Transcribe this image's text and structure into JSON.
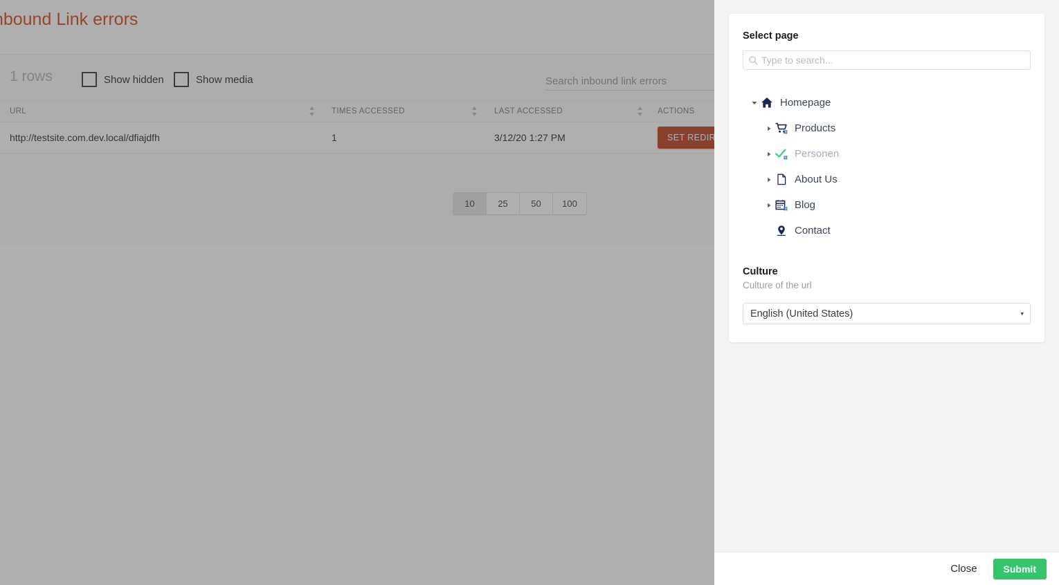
{
  "background_page": {
    "title": "Inbound Link errors",
    "title_visible_fragment": "nbound Link errors",
    "rows_count_label": "1 rows",
    "checkboxes": [
      {
        "name": "show-hidden",
        "label": "Show hidden",
        "checked": false
      },
      {
        "name": "show-media",
        "label": "Show media",
        "checked": false
      }
    ],
    "search": {
      "placeholder": "Search inbound link errors",
      "value": ""
    },
    "table": {
      "columns": [
        "URL",
        "TIMES ACCESSED",
        "LAST ACCESSED",
        "ACTIONS"
      ],
      "rows": [
        {
          "url": "http://testsite.com.dev.local/dfiajdfh",
          "times_accessed": "1",
          "last_accessed": "3/12/20 1:27 PM",
          "action_label": "SET REDIRECT"
        }
      ]
    },
    "pagination": {
      "options": [
        "10",
        "25",
        "50",
        "100"
      ],
      "selected": "10"
    }
  },
  "panel": {
    "heading": "Select page",
    "search": {
      "placeholder": "Type to search...",
      "value": ""
    },
    "tree": [
      {
        "label": "Homepage",
        "level": 0,
        "icon": "home-icon",
        "expanded": true,
        "has_children": true,
        "muted": false
      },
      {
        "label": "Products",
        "level": 1,
        "icon": "cart-icon",
        "expanded": false,
        "has_children": true,
        "muted": false
      },
      {
        "label": "Personen",
        "level": 1,
        "icon": "check-icon",
        "expanded": false,
        "has_children": true,
        "muted": true
      },
      {
        "label": "About Us",
        "level": 1,
        "icon": "document-icon",
        "expanded": false,
        "has_children": true,
        "muted": false
      },
      {
        "label": "Blog",
        "level": 1,
        "icon": "calendar-icon",
        "expanded": false,
        "has_children": true,
        "muted": false
      },
      {
        "label": "Contact",
        "level": 1,
        "icon": "map-pin-icon",
        "expanded": false,
        "has_children": false,
        "muted": false
      }
    ],
    "culture": {
      "heading": "Culture",
      "description": "Culture of the url",
      "selected": "English (United States)",
      "caret": "▾"
    },
    "footer": {
      "close_label": "Close",
      "submit_label": "Submit"
    }
  },
  "colors": {
    "title_orange": "#d4491f",
    "action_button": "#c2401c",
    "submit_green": "#35c46c",
    "panel_background": "#f4f4f5",
    "tree_icon_navy": "#1d2757",
    "tree_check_green": "#3fc97e",
    "overlay_dim": "rgba(64,64,64,0.42)"
  }
}
